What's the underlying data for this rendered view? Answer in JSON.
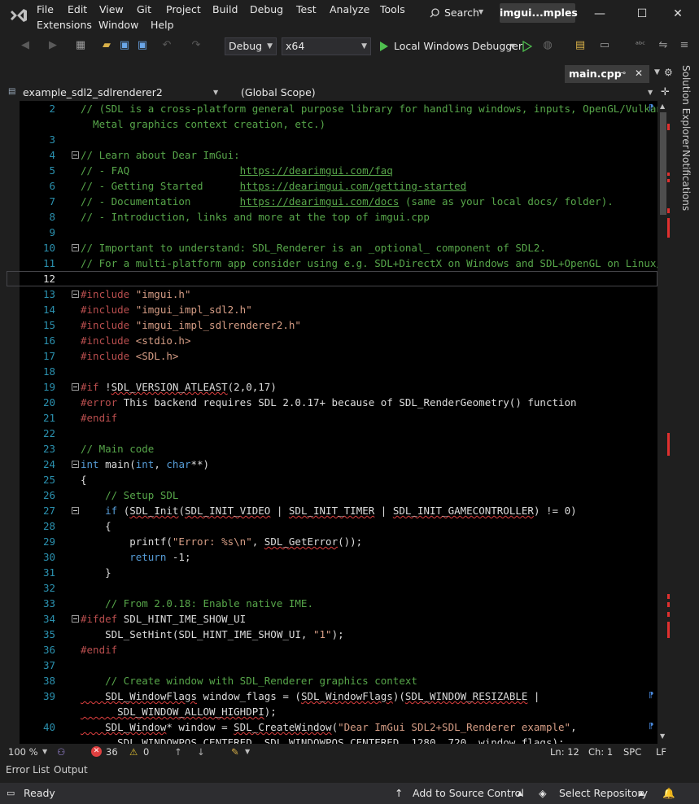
{
  "menu": [
    "File",
    "Edit",
    "View",
    "Git",
    "Project",
    "Build",
    "Debug",
    "Test",
    "Analyze",
    "Tools",
    "Extensions",
    "Window",
    "Help"
  ],
  "search_label": "Search",
  "solution_name": "imgui...mples",
  "toolbar": {
    "config": "Debug",
    "platform": "x64",
    "debugger": "Local Windows Debugger"
  },
  "doc_tab": "main.cpp",
  "nav": {
    "project": "example_sdl2_sdlrenderer2",
    "scope": "(Global Scope)"
  },
  "side_panel": {
    "solution_explorer": "Solution Explorer",
    "notifications": "Notifications"
  },
  "editor_status": {
    "zoom": "100 %",
    "errors": "36",
    "warnings": "0",
    "line": "Ln: 12",
    "col": "Ch: 1",
    "spc": "SPC",
    "eol": "LF"
  },
  "tool_tabs": [
    "Error List",
    "Output"
  ],
  "status": {
    "ready": "Ready",
    "source_control": "Add to Source Control",
    "repository": "Select Repository"
  },
  "code_lines": [
    {
      "n": "2",
      "segs": [
        [
          "c-com",
          "// (SDL is a cross-platform general purpose library for handling windows, inputs, OpenGL/Vulkan/"
        ]
      ]
    },
    {
      "n": "",
      "segs": [
        [
          "c-com",
          "  Metal graphics context creation, etc.)"
        ]
      ]
    },
    {
      "n": "3",
      "segs": []
    },
    {
      "n": "4",
      "fold": true,
      "segs": [
        [
          "c-com",
          "// Learn about Dear ImGui:"
        ]
      ]
    },
    {
      "n": "5",
      "segs": [
        [
          "c-com",
          "// - FAQ                  "
        ],
        [
          "c-link",
          "https://dearimgui.com/faq"
        ]
      ]
    },
    {
      "n": "6",
      "segs": [
        [
          "c-com",
          "// - Getting Started      "
        ],
        [
          "c-link",
          "https://dearimgui.com/getting-started"
        ]
      ]
    },
    {
      "n": "7",
      "segs": [
        [
          "c-com",
          "// - Documentation        "
        ],
        [
          "c-link",
          "https://dearimgui.com/docs"
        ],
        [
          "c-com",
          " (same as your local docs/ folder)."
        ]
      ]
    },
    {
      "n": "8",
      "segs": [
        [
          "c-com",
          "// - Introduction, links and more at the top of imgui.cpp"
        ]
      ]
    },
    {
      "n": "9",
      "segs": []
    },
    {
      "n": "10",
      "fold": true,
      "segs": [
        [
          "c-com",
          "// Important to understand: SDL_Renderer is an _optional_ component of SDL2."
        ]
      ]
    },
    {
      "n": "11",
      "segs": [
        [
          "c-com",
          "// For a multi-platform app consider using e.g. SDL+DirectX on Windows and SDL+OpenGL on Linux/OSX."
        ]
      ]
    },
    {
      "n": "12",
      "cur": true,
      "segs": []
    },
    {
      "n": "13",
      "fold": true,
      "segs": [
        [
          "c-pp",
          "#include "
        ],
        [
          "c-str",
          "\"imgui.h\""
        ]
      ]
    },
    {
      "n": "14",
      "segs": [
        [
          "c-pp",
          "#include "
        ],
        [
          "c-str",
          "\"imgui_impl_sdl2.h\""
        ]
      ]
    },
    {
      "n": "15",
      "segs": [
        [
          "c-pp",
          "#include "
        ],
        [
          "c-str",
          "\"imgui_impl_sdlrenderer2.h\""
        ]
      ]
    },
    {
      "n": "16",
      "segs": [
        [
          "c-pp",
          "#include "
        ],
        [
          "c-str",
          "<stdio.h>"
        ]
      ]
    },
    {
      "n": "17",
      "segs": [
        [
          "c-pp",
          "#include "
        ],
        [
          "c-str",
          "<SDL.h>"
        ]
      ]
    },
    {
      "n": "18",
      "segs": []
    },
    {
      "n": "19",
      "fold": true,
      "segs": [
        [
          "c-pp",
          "#if "
        ],
        [
          "c-txt",
          "!"
        ],
        [
          "c-txt squig",
          "SDL_VERSION_ATLEAST"
        ],
        [
          "c-txt",
          "(2,0,17)"
        ]
      ]
    },
    {
      "n": "20",
      "segs": [
        [
          "c-pp",
          "#error "
        ],
        [
          "c-txt",
          "This backend requires SDL 2.0.17+ because of SDL_RenderGeometry() function"
        ]
      ]
    },
    {
      "n": "21",
      "segs": [
        [
          "c-pp",
          "#endif"
        ]
      ]
    },
    {
      "n": "22",
      "segs": []
    },
    {
      "n": "23",
      "segs": [
        [
          "c-com",
          "// Main code"
        ]
      ]
    },
    {
      "n": "24",
      "fold": true,
      "segs": [
        [
          "c-kw",
          "int "
        ],
        [
          "c-txt",
          "main("
        ],
        [
          "c-kw",
          "int"
        ],
        [
          "c-txt",
          ", "
        ],
        [
          "c-kw",
          "char"
        ],
        [
          "c-txt",
          "**)"
        ]
      ]
    },
    {
      "n": "25",
      "segs": [
        [
          "c-txt",
          "{"
        ]
      ]
    },
    {
      "n": "26",
      "segs": [
        [
          "c-com",
          "    // Setup SDL"
        ]
      ]
    },
    {
      "n": "27",
      "fold": true,
      "segs": [
        [
          "c-kw",
          "    if "
        ],
        [
          "c-txt",
          "("
        ],
        [
          "c-txt squig",
          "SDL_Init"
        ],
        [
          "c-txt",
          "("
        ],
        [
          "c-txt squig",
          "SDL_INIT_VIDEO"
        ],
        [
          "c-txt",
          " | "
        ],
        [
          "c-txt squig",
          "SDL_INIT_TIMER"
        ],
        [
          "c-txt",
          " | "
        ],
        [
          "c-txt squig",
          "SDL_INIT_GAMECONTROLLER"
        ],
        [
          "c-txt",
          ") != 0)"
        ]
      ]
    },
    {
      "n": "28",
      "segs": [
        [
          "c-txt",
          "    {"
        ]
      ]
    },
    {
      "n": "29",
      "segs": [
        [
          "c-txt",
          "        printf("
        ],
        [
          "c-str",
          "\"Error: %s\\n\""
        ],
        [
          "c-txt",
          ", "
        ],
        [
          "c-txt squig",
          "SDL_GetError"
        ],
        [
          "c-txt",
          "());"
        ]
      ]
    },
    {
      "n": "30",
      "segs": [
        [
          "c-kw",
          "        return "
        ],
        [
          "c-txt",
          "-1;"
        ]
      ]
    },
    {
      "n": "31",
      "segs": [
        [
          "c-txt",
          "    }"
        ]
      ]
    },
    {
      "n": "32",
      "segs": []
    },
    {
      "n": "33",
      "segs": [
        [
          "c-com",
          "    // From 2.0.18: Enable native IME."
        ]
      ]
    },
    {
      "n": "34",
      "fold": true,
      "segs": [
        [
          "c-pp",
          "#ifdef "
        ],
        [
          "c-txt",
          "SDL_HINT_IME_SHOW_UI"
        ]
      ]
    },
    {
      "n": "35",
      "segs": [
        [
          "c-txt",
          "    SDL_SetHint(SDL_HINT_IME_SHOW_UI, "
        ],
        [
          "c-str",
          "\"1\""
        ],
        [
          "c-txt",
          ");"
        ]
      ]
    },
    {
      "n": "36",
      "segs": [
        [
          "c-pp",
          "#endif"
        ]
      ]
    },
    {
      "n": "37",
      "segs": []
    },
    {
      "n": "38",
      "segs": [
        [
          "c-com",
          "    // Create window with SDL_Renderer graphics context"
        ]
      ]
    },
    {
      "n": "39",
      "segs": [
        [
          "c-txt squig",
          "    SDL_WindowFlags"
        ],
        [
          "c-txt",
          " window_flags = ("
        ],
        [
          "c-txt squig",
          "SDL_WindowFlags"
        ],
        [
          "c-txt",
          ")("
        ],
        [
          "c-txt squig",
          "SDL_WINDOW_RESIZABLE"
        ],
        [
          "c-txt",
          " |"
        ]
      ]
    },
    {
      "n": "",
      "segs": [
        [
          "c-txt squig",
          "      SDL_WINDOW_ALLOW_HIGHDPI"
        ],
        [
          "c-txt",
          ");"
        ]
      ]
    },
    {
      "n": "40",
      "segs": [
        [
          "c-txt squig",
          "    SDL_Window"
        ],
        [
          "c-txt",
          "* window = "
        ],
        [
          "c-txt squig",
          "SDL_CreateWindow"
        ],
        [
          "c-txt",
          "("
        ],
        [
          "c-str",
          "\"Dear ImGui SDL2+SDL_Renderer example\""
        ],
        [
          "c-txt",
          ","
        ]
      ]
    },
    {
      "n": "",
      "segs": [
        [
          "c-txt",
          "      SDL_WINDOWPOS_CENTERED, SDL_WINDOWPOS_CENTERED, 1280, 720, window_flags);"
        ]
      ]
    }
  ]
}
